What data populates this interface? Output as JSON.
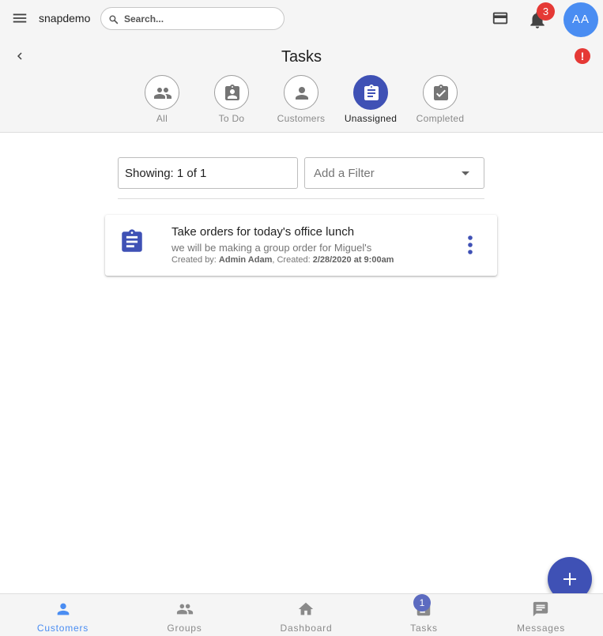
{
  "app": {
    "name": "snapdemo"
  },
  "search": {
    "placeholder": "Search..."
  },
  "notifications": {
    "count": "3"
  },
  "user": {
    "initials": "AA"
  },
  "page": {
    "title": "Tasks"
  },
  "tabs": [
    {
      "label": "All",
      "icon": "people-icon",
      "active": false
    },
    {
      "label": "To Do",
      "icon": "assignment-ind-icon",
      "active": false
    },
    {
      "label": "Customers",
      "icon": "person-icon",
      "active": false
    },
    {
      "label": "Unassigned",
      "icon": "assignment-icon",
      "active": true
    },
    {
      "label": "Completed",
      "icon": "assignment-turned-in-icon",
      "active": false
    }
  ],
  "filters": {
    "showing": "Showing: 1 of 1",
    "add_filter_placeholder": "Add a Filter"
  },
  "tasks": [
    {
      "title": "Take orders for today's office lunch",
      "description": "we will be making a group order for Miguel's",
      "created_by_label": "Created by: ",
      "created_by": "Admin Adam",
      "created_label": ", Created: ",
      "created": "2/28/2020 at 9:00am"
    }
  ],
  "bottom_nav": [
    {
      "label": "Customers",
      "icon": "person-icon",
      "active": true
    },
    {
      "label": "Groups",
      "icon": "group-icon",
      "active": false
    },
    {
      "label": "Dashboard",
      "icon": "home-icon",
      "active": false
    },
    {
      "label": "Tasks",
      "icon": "task-icon",
      "active": false,
      "badge": "1"
    },
    {
      "label": "Messages",
      "icon": "chat-icon",
      "active": false
    }
  ],
  "colors": {
    "primary": "#3f51b5",
    "accent_blue": "#4a8df2",
    "alert_red": "#e53935",
    "header_bg": "#f5f5f5",
    "muted_text": "#8a8a8a"
  }
}
